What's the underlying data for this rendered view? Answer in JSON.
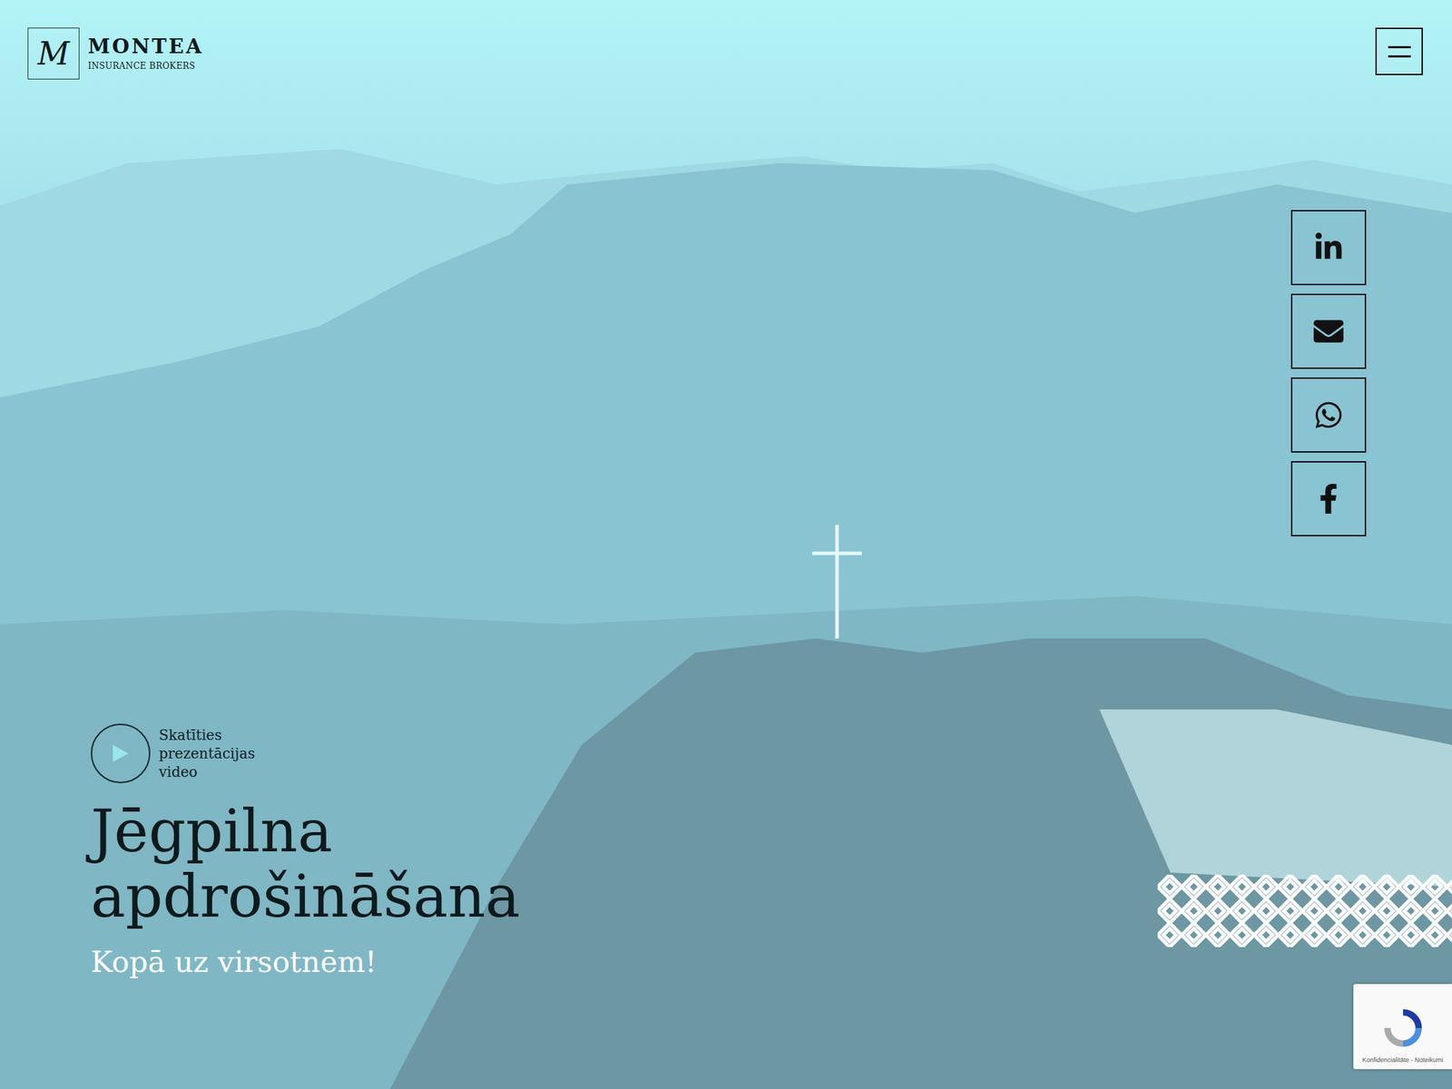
{
  "logo": {
    "mark": "M",
    "name": "MONTEA",
    "tagline": "INSURANCE BROKERS"
  },
  "social_links": [
    {
      "kind": "linkedin"
    },
    {
      "kind": "email"
    },
    {
      "kind": "whatsapp"
    },
    {
      "kind": "facebook"
    }
  ],
  "video_link": {
    "lines": [
      "Skatīties",
      "prezentācijas",
      "video"
    ]
  },
  "hero": {
    "title_lines": [
      "Jēgpilna",
      "apdrošināšana"
    ],
    "subtitle": "Kopā uz virsotnēm!"
  },
  "recaptcha": {
    "links": "Konfidencialitāte - Noteikumi"
  }
}
